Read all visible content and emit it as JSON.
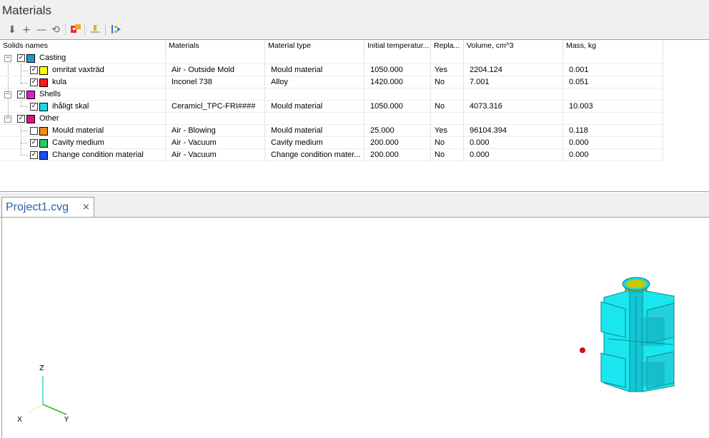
{
  "panel": {
    "title": "Materials"
  },
  "toolbar": {
    "icons": [
      "move-down-icon",
      "add-icon",
      "remove-icon",
      "refresh-icon",
      "assign-material-icon",
      "baseline-icon",
      "align-icon"
    ]
  },
  "grid": {
    "headers": [
      "Solids names",
      "Materials",
      "Material type",
      "Initial temperatur...",
      "Repla...",
      "Volume, cm^3",
      "Mass, kg"
    ],
    "rows": [
      {
        "name": "Casting",
        "group": true,
        "checked": true,
        "color": "#1a9ad6",
        "material": "",
        "type": "",
        "temp": "",
        "replace": "",
        "volume": "",
        "mass": ""
      },
      {
        "name": "omritat vaxträd",
        "group": false,
        "checked": true,
        "color": "#ffff00",
        "material": "Air - Outside Mold",
        "type": "Mould material",
        "temp": "1050.000",
        "replace": "Yes",
        "volume": "2204.124",
        "mass": "0.001"
      },
      {
        "name": "kula",
        "group": false,
        "checked": true,
        "color": "#ff1a1a",
        "material": "Inconel 738",
        "type": "Alloy",
        "temp": "1420.000",
        "replace": "No",
        "volume": "7.001",
        "mass": "0.051"
      },
      {
        "name": "Shells",
        "group": true,
        "checked": true,
        "color": "#e01ad6",
        "material": "",
        "type": "",
        "temp": "",
        "replace": "",
        "volume": "",
        "mass": ""
      },
      {
        "name": "ihåligt skal",
        "group": false,
        "checked": true,
        "color": "#1ad6e6",
        "material": "Ceramicl_TPC-FRI####",
        "type": "Mould material",
        "temp": "1050.000",
        "replace": "No",
        "volume": "4073.316",
        "mass": "10.003"
      },
      {
        "name": "Other",
        "group": true,
        "checked": true,
        "color": "#e0127a",
        "material": "",
        "type": "",
        "temp": "",
        "replace": "",
        "volume": "",
        "mass": ""
      },
      {
        "name": "Mould material",
        "group": false,
        "checked": false,
        "color": "#f28a1f",
        "material": "Air - Blowing",
        "type": "Mould material",
        "temp": "25.000",
        "replace": "Yes",
        "volume": "96104.394",
        "mass": "0.118"
      },
      {
        "name": "Cavity medium",
        "group": false,
        "checked": true,
        "color": "#2fc46a",
        "material": "Air - Vacuum",
        "type": "Cavity medium",
        "temp": "200.000",
        "replace": "No",
        "volume": "0.000",
        "mass": "0.000"
      },
      {
        "name": "Change condition material",
        "group": false,
        "checked": true,
        "color": "#1a4ee6",
        "material": "Air - Vacuum",
        "type": "Change condition mater...",
        "temp": "200.000",
        "replace": "No",
        "volume": "0.000",
        "mass": "0.000"
      }
    ]
  },
  "document_tab": {
    "label": "Project1.cvg",
    "close": "×"
  },
  "viewport": {
    "axes": {
      "z": "Z",
      "x": "X",
      "y": "Y"
    }
  }
}
